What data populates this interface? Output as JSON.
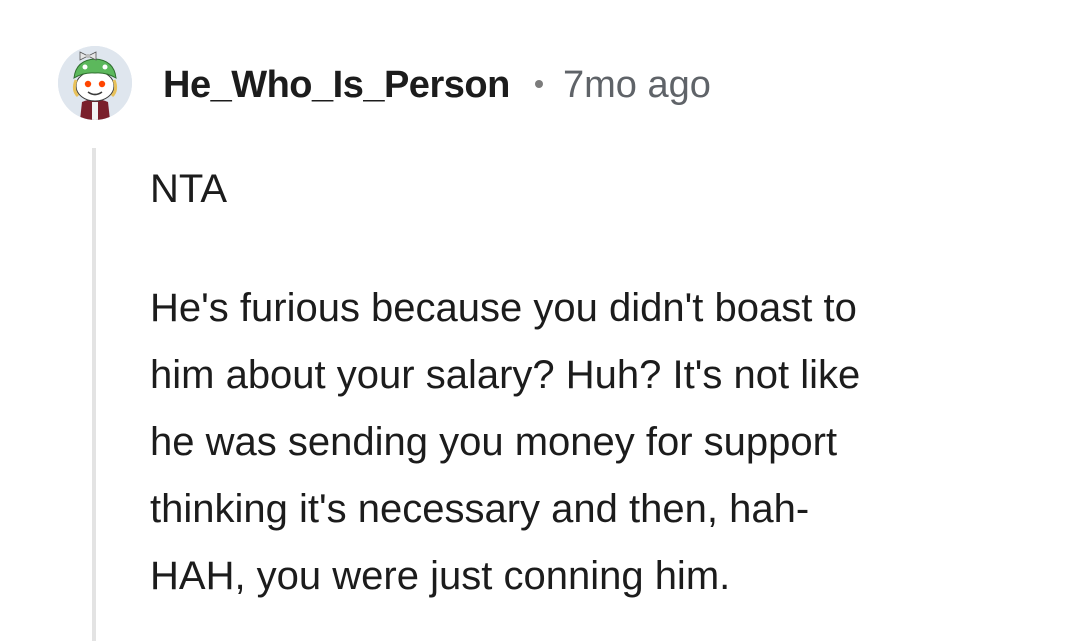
{
  "comment": {
    "author": "He_Who_Is_Person",
    "separator": "•",
    "timestamp": "7mo ago",
    "avatar_icon": "snoo-avatar-icon",
    "paragraphs": [
      "NTA",
      "He's furious because you didn't boast to\nhim about your salary? Huh? It's not like\nhe was sending you money for support\nthinking it's necessary and then, hah-\nHAH, you were just conning him."
    ]
  },
  "colors": {
    "text": "#1c1c1c",
    "meta": "#5f6368",
    "thread_line": "#e3e3e3",
    "avatar_bg": "#dfe6ee",
    "avatar_hat": "#5cb85c"
  }
}
